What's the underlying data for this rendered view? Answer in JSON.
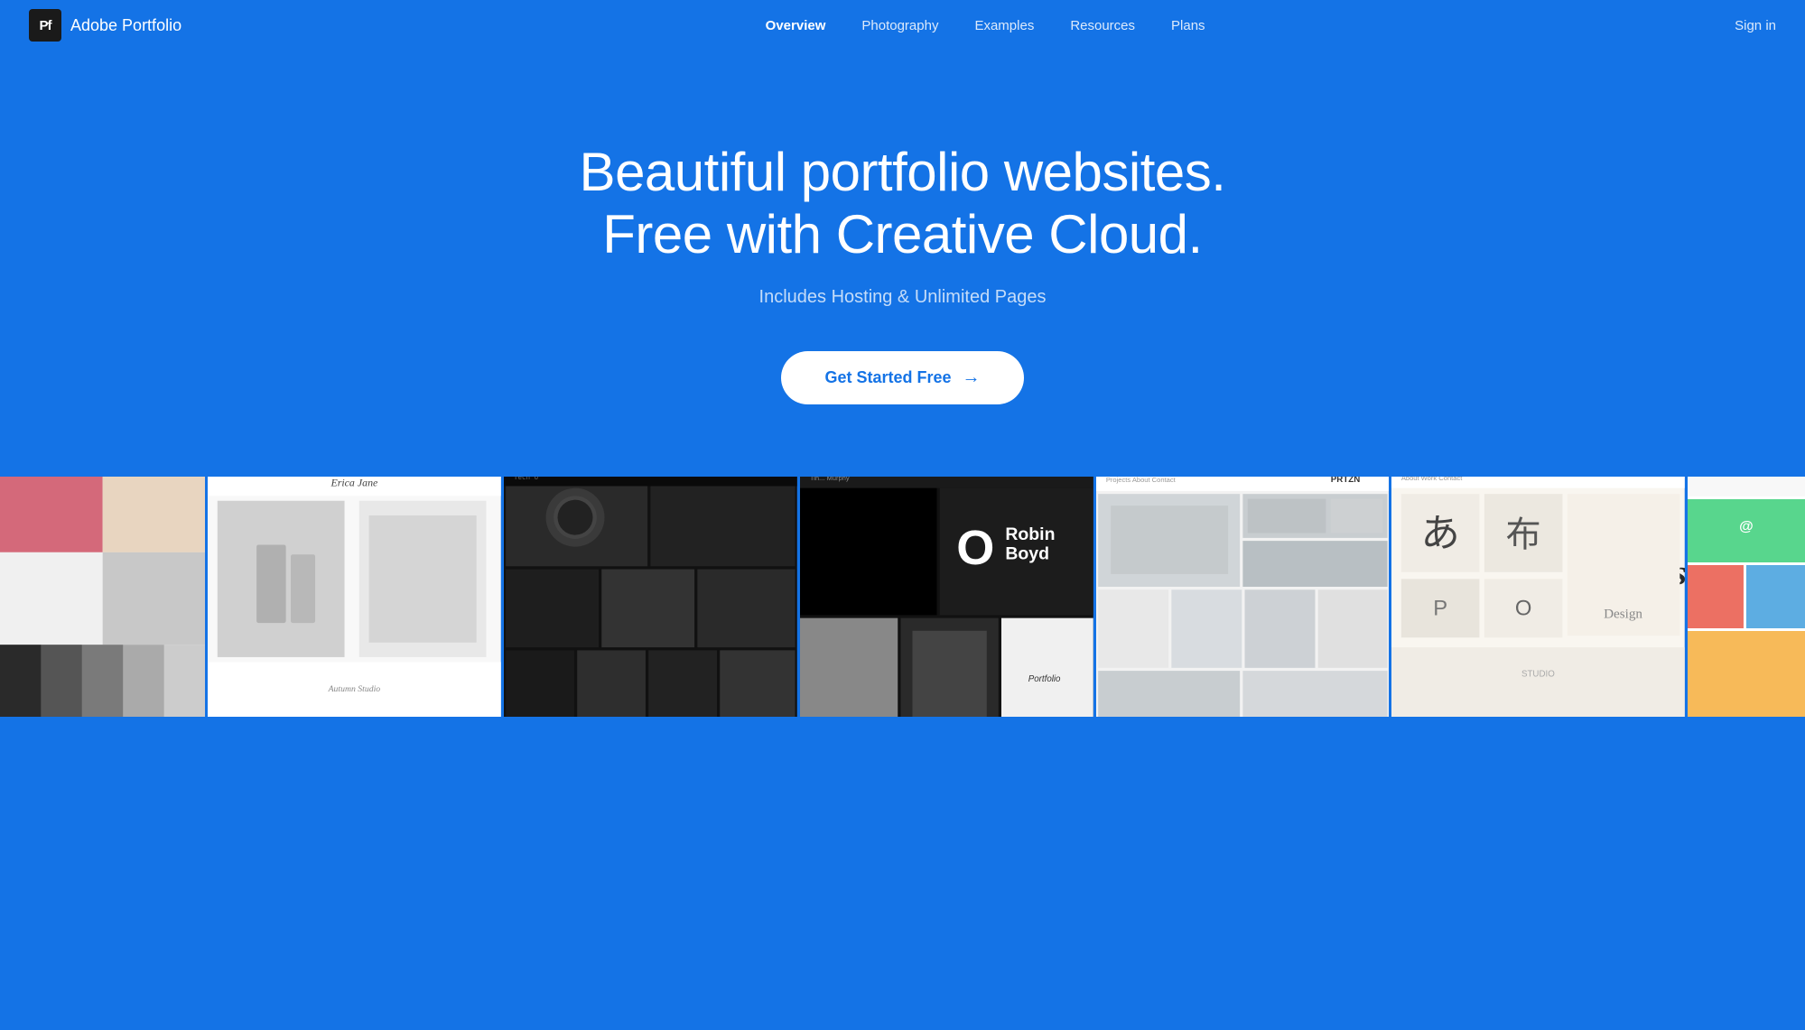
{
  "app": {
    "logo_initials": "Pf",
    "app_name": "Adobe Portfolio"
  },
  "nav": {
    "links": [
      {
        "id": "overview",
        "label": "Overview",
        "active": true
      },
      {
        "id": "photography",
        "label": "Photography",
        "active": false
      },
      {
        "id": "examples",
        "label": "Examples",
        "active": false
      },
      {
        "id": "resources",
        "label": "Resources",
        "active": false
      },
      {
        "id": "plans",
        "label": "Plans",
        "active": false
      }
    ],
    "signin_label": "Sign in"
  },
  "hero": {
    "title_line1": "Beautiful portfolio websites.",
    "title_line2": "Free with Creative Cloud.",
    "subtitle": "Includes Hosting & Unlimited Pages",
    "cta_label": "Get Started Free",
    "cta_arrow": "→"
  },
  "colors": {
    "brand_blue": "#1473e6",
    "white": "#ffffff",
    "nav_link_active": "#ffffff",
    "nav_link_inactive": "rgba(255,255,255,0.85)"
  }
}
